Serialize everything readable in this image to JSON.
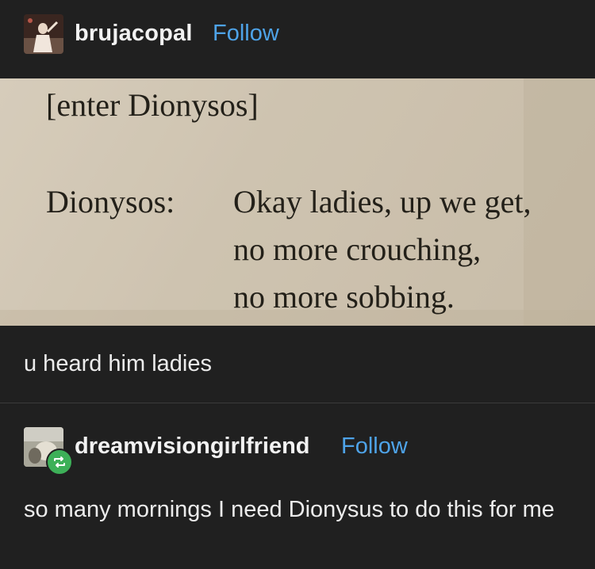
{
  "post": {
    "username": "brujacopal",
    "follow_label": "Follow",
    "photo": {
      "stage_direction": "[enter Dionysos]",
      "speaker": "Dionysos:",
      "lines": [
        "Okay ladies, up we get,",
        "no more crouching,",
        "no more sobbing."
      ]
    },
    "caption": "u heard him ladies"
  },
  "reblog": {
    "username": "dreamvisiongirlfriend",
    "follow_label": "Follow",
    "text": "so many mornings I need Dionysus to do this for me"
  },
  "icons": [
    "avatar-image",
    "reblog-icon"
  ],
  "colors": {
    "background": "#202020",
    "follow": "#4ea3e8",
    "reblog_badge": "#3db058"
  }
}
